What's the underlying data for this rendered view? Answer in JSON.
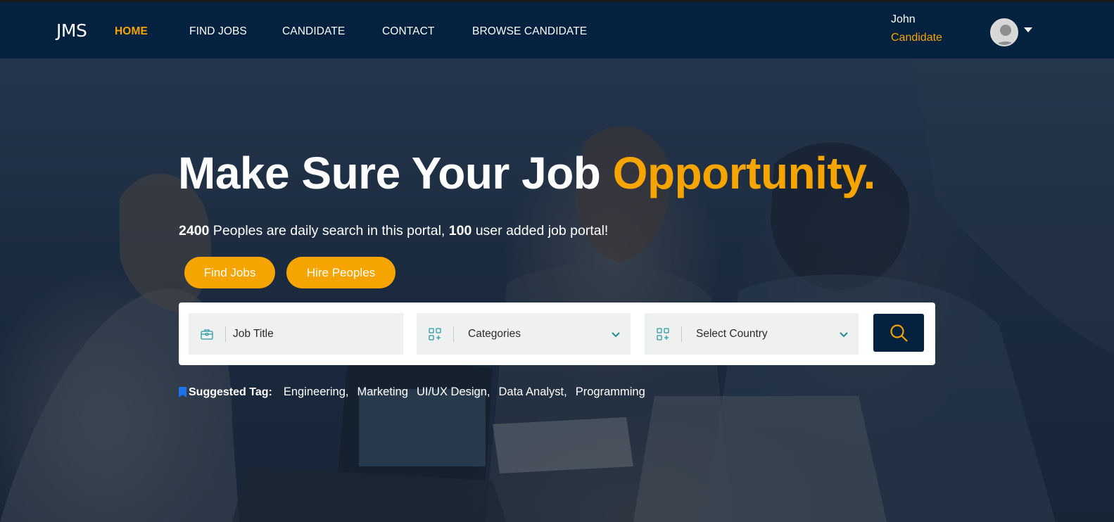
{
  "nav": {
    "logo": "JMS",
    "links": [
      "HOME",
      "FIND JOBS",
      "CANDIDATE",
      "CONTACT",
      "BROWSE CANDIDATE"
    ],
    "active_color": "#f5a400"
  },
  "user": {
    "name": "John",
    "role": "Candidate",
    "avatar_icon": "user-avatar-icon"
  },
  "hero": {
    "headline": "Make Sure Your Job ",
    "headline_accent": "Opportunity.",
    "subline": {
      "count1": "2400",
      "text1": " Peoples are daily search in this portal, ",
      "count2": "100",
      "text2": " user added job portal!"
    },
    "buttons": {
      "find_jobs": "Find Jobs",
      "hire": "Hire Peoples"
    }
  },
  "search": {
    "job_title": "Job Title",
    "categories": "Categories",
    "country": "Select Country",
    "button_icon": "search-icon"
  },
  "tags": {
    "label": "Suggested Tag:",
    "items": [
      "Engineering,",
      "Marketing",
      "UI/UX Design,",
      "Data Analyst,",
      "Programming"
    ]
  },
  "colors": {
    "navy": "#04213f",
    "accent": "#f5a400",
    "field_bg": "#eef1f0",
    "icon_teal": "#2a9aa3"
  }
}
